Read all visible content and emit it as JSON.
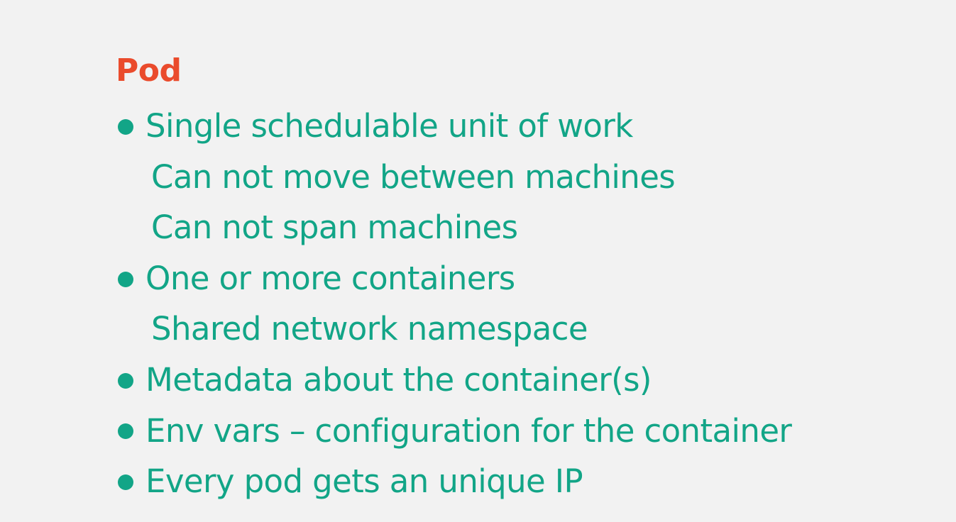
{
  "title": "Pod",
  "items": [
    {
      "level": 0,
      "text": "Single schedulable unit of work"
    },
    {
      "level": 1,
      "text": "Can not move between machines"
    },
    {
      "level": 1,
      "text": "Can not span machines"
    },
    {
      "level": 0,
      "text": "One or more containers"
    },
    {
      "level": 1,
      "text": "Shared network namespace"
    },
    {
      "level": 0,
      "text": "Metadata about the container(s)"
    },
    {
      "level": 0,
      "text": "Env vars – configuration for the container"
    },
    {
      "level": 0,
      "text": "Every pod gets an unique IP"
    }
  ],
  "colors": {
    "title": "#ea4b2c",
    "text": "#12a587",
    "background": "#f2f2f2"
  }
}
